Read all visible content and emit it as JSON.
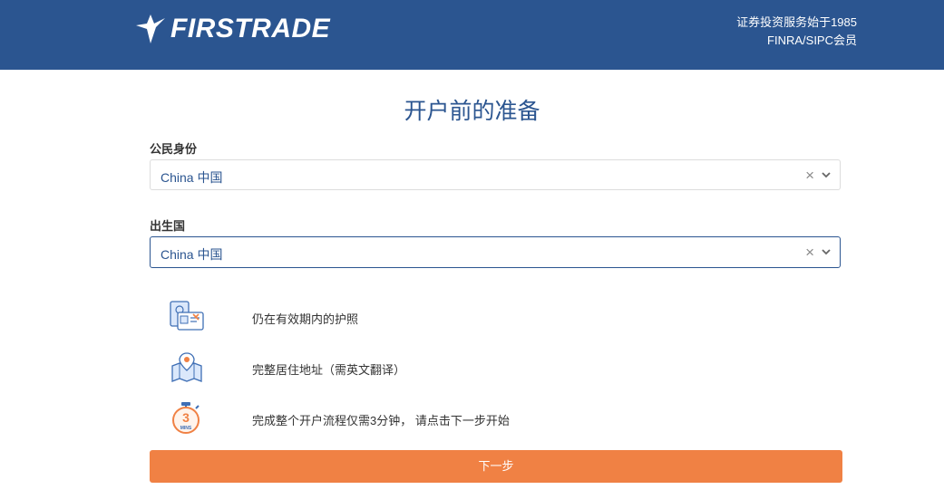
{
  "header": {
    "logo_text": "FIRSTRADE",
    "tagline_1": "证券投资服务始于1985",
    "tagline_2": "FINRA/SIPC会员",
    "background_color": "#2b5590"
  },
  "page_title": "开户前的准备",
  "form": {
    "citizenship_label": "公民身份",
    "citizenship_value": "China 中国",
    "birth_country_label": "出生国",
    "birth_country_value": "China 中国"
  },
  "checklist": [
    {
      "icon": "passport-icon",
      "text": "仍在有效期内的护照"
    },
    {
      "icon": "map-location-icon",
      "text": "完整居住地址（需英文翻译）"
    },
    {
      "icon": "stopwatch-icon",
      "icon_label": "3",
      "icon_sub": "MINS",
      "text": "完成整个开户流程仅需3分钟， 请点击下一步开始"
    }
  ],
  "next_button_label": "下一步",
  "accent_color": "#f08144"
}
